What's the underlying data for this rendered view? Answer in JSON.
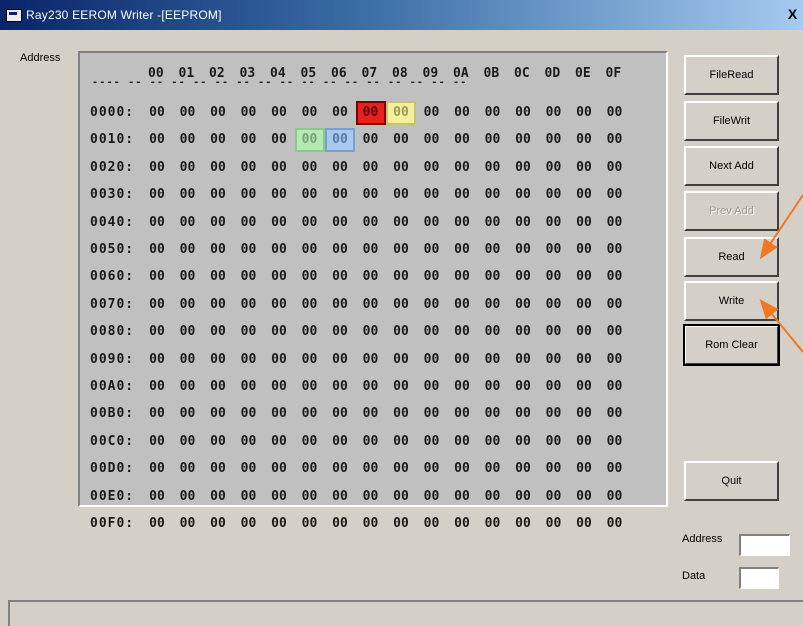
{
  "window": {
    "title": "Ray230 EEROM Writer -[EEPROM]",
    "close_label": "X"
  },
  "grid": {
    "label": "Address",
    "column_headers": [
      "00",
      "01",
      "02",
      "03",
      "04",
      "05",
      "06",
      "07",
      "08",
      "09",
      "0A",
      "0B",
      "0C",
      "0D",
      "0E",
      "0F"
    ],
    "separator": "---- -- -- -- -- -- -- -- -- -- -- -- -- -- -- -- --",
    "rows": [
      {
        "addr": "0000:",
        "cells": [
          "00",
          "00",
          "00",
          "00",
          "00",
          "00",
          "00",
          "00",
          "00",
          "00",
          "00",
          "00",
          "00",
          "00",
          "00",
          "00"
        ]
      },
      {
        "addr": "0010:",
        "cells": [
          "00",
          "00",
          "00",
          "00",
          "00",
          "00",
          "00",
          "00",
          "00",
          "00",
          "00",
          "00",
          "00",
          "00",
          "00",
          "00"
        ]
      },
      {
        "addr": "0020:",
        "cells": [
          "00",
          "00",
          "00",
          "00",
          "00",
          "00",
          "00",
          "00",
          "00",
          "00",
          "00",
          "00",
          "00",
          "00",
          "00",
          "00"
        ]
      },
      {
        "addr": "0030:",
        "cells": [
          "00",
          "00",
          "00",
          "00",
          "00",
          "00",
          "00",
          "00",
          "00",
          "00",
          "00",
          "00",
          "00",
          "00",
          "00",
          "00"
        ]
      },
      {
        "addr": "0040:",
        "cells": [
          "00",
          "00",
          "00",
          "00",
          "00",
          "00",
          "00",
          "00",
          "00",
          "00",
          "00",
          "00",
          "00",
          "00",
          "00",
          "00"
        ]
      },
      {
        "addr": "0050:",
        "cells": [
          "00",
          "00",
          "00",
          "00",
          "00",
          "00",
          "00",
          "00",
          "00",
          "00",
          "00",
          "00",
          "00",
          "00",
          "00",
          "00"
        ]
      },
      {
        "addr": "0060:",
        "cells": [
          "00",
          "00",
          "00",
          "00",
          "00",
          "00",
          "00",
          "00",
          "00",
          "00",
          "00",
          "00",
          "00",
          "00",
          "00",
          "00"
        ]
      },
      {
        "addr": "0070:",
        "cells": [
          "00",
          "00",
          "00",
          "00",
          "00",
          "00",
          "00",
          "00",
          "00",
          "00",
          "00",
          "00",
          "00",
          "00",
          "00",
          "00"
        ]
      },
      {
        "addr": "0080:",
        "cells": [
          "00",
          "00",
          "00",
          "00",
          "00",
          "00",
          "00",
          "00",
          "00",
          "00",
          "00",
          "00",
          "00",
          "00",
          "00",
          "00"
        ]
      },
      {
        "addr": "0090:",
        "cells": [
          "00",
          "00",
          "00",
          "00",
          "00",
          "00",
          "00",
          "00",
          "00",
          "00",
          "00",
          "00",
          "00",
          "00",
          "00",
          "00"
        ]
      },
      {
        "addr": "00A0:",
        "cells": [
          "00",
          "00",
          "00",
          "00",
          "00",
          "00",
          "00",
          "00",
          "00",
          "00",
          "00",
          "00",
          "00",
          "00",
          "00",
          "00"
        ]
      },
      {
        "addr": "00B0:",
        "cells": [
          "00",
          "00",
          "00",
          "00",
          "00",
          "00",
          "00",
          "00",
          "00",
          "00",
          "00",
          "00",
          "00",
          "00",
          "00",
          "00"
        ]
      },
      {
        "addr": "00C0:",
        "cells": [
          "00",
          "00",
          "00",
          "00",
          "00",
          "00",
          "00",
          "00",
          "00",
          "00",
          "00",
          "00",
          "00",
          "00",
          "00",
          "00"
        ]
      },
      {
        "addr": "00D0:",
        "cells": [
          "00",
          "00",
          "00",
          "00",
          "00",
          "00",
          "00",
          "00",
          "00",
          "00",
          "00",
          "00",
          "00",
          "00",
          "00",
          "00"
        ]
      },
      {
        "addr": "00E0:",
        "cells": [
          "00",
          "00",
          "00",
          "00",
          "00",
          "00",
          "00",
          "00",
          "00",
          "00",
          "00",
          "00",
          "00",
          "00",
          "00",
          "00"
        ]
      },
      {
        "addr": "00F0:",
        "cells": [
          "00",
          "00",
          "00",
          "00",
          "00",
          "00",
          "00",
          "00",
          "00",
          "00",
          "00",
          "00",
          "00",
          "00",
          "00",
          "00"
        ]
      }
    ],
    "highlights": [
      {
        "row": 0,
        "col": 7,
        "color": "red"
      },
      {
        "row": 0,
        "col": 8,
        "color": "yellow"
      },
      {
        "row": 1,
        "col": 5,
        "color": "green"
      },
      {
        "row": 1,
        "col": 6,
        "color": "blue"
      }
    ]
  },
  "buttons": {
    "file_read": "FileRead",
    "file_write": "FileWrit",
    "next_add": "Next Add",
    "prev_add": "Prev Add",
    "read": "Read",
    "write": "Write",
    "rom_clear": "Rom Clear",
    "quit": "Quit"
  },
  "fields": {
    "address_label": "Address",
    "address_value": "",
    "data_label": "Data",
    "data_value": ""
  },
  "colors": {
    "highlight_red": "#e8211e",
    "highlight_yellow": "#f4ef9d",
    "highlight_green": "#b6e8b2",
    "highlight_blue": "#a9c8f0",
    "annotation_arrow": "#f07820"
  }
}
